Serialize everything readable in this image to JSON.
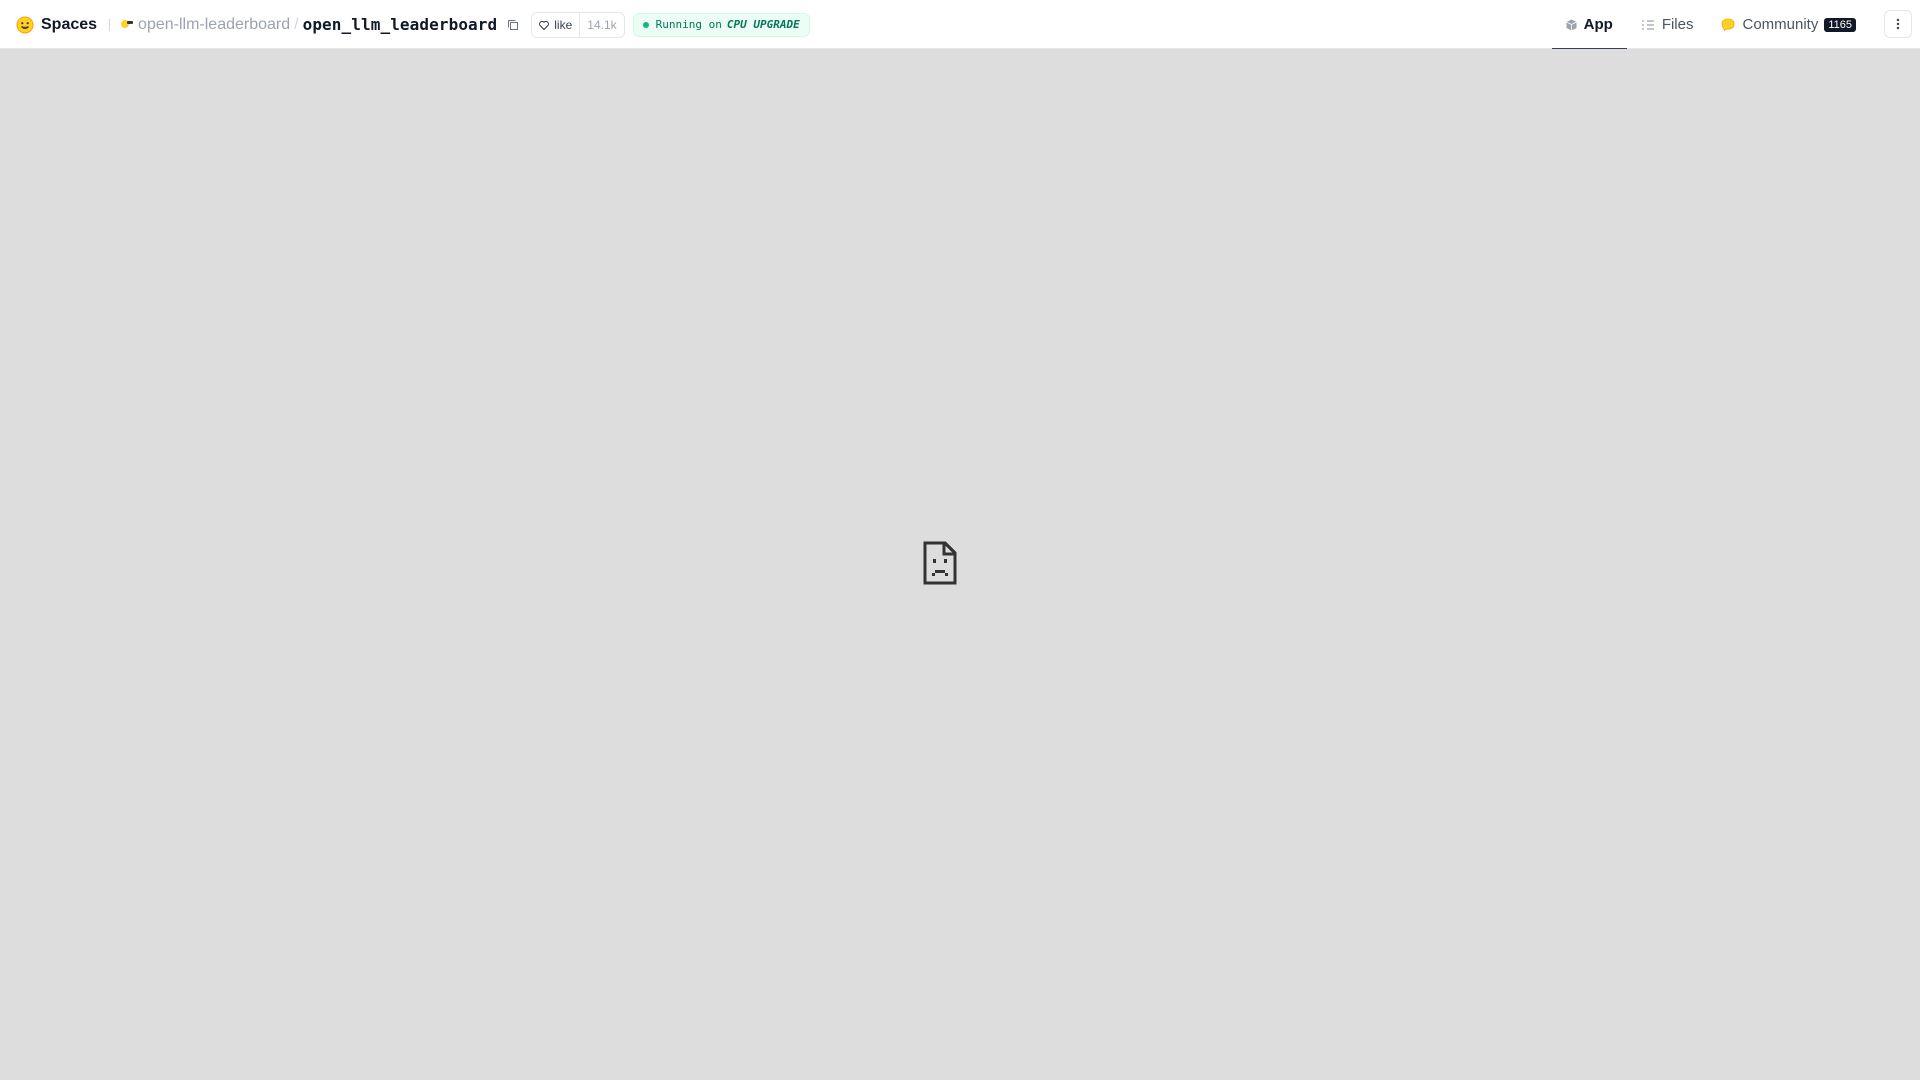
{
  "header": {
    "brand_label": "Spaces",
    "brand_icon": "huggingface-logo-icon",
    "owner": "open-llm-leaderboard",
    "separator": "/",
    "repo": "open_llm_leaderboard",
    "like_label": "like",
    "like_count": "14.1k",
    "status": {
      "text": "Running on",
      "hardware": "CPU UPGRADE",
      "color": "#10b981"
    }
  },
  "tabs": [
    {
      "label": "App",
      "icon": "cube-icon",
      "active": true
    },
    {
      "label": "Files",
      "icon": "files-icon",
      "active": false
    },
    {
      "label": "Community",
      "icon": "community-icon",
      "active": false,
      "count": "1165"
    }
  ],
  "content": {
    "state_icon": "sad-file-icon",
    "background": "#dddddd"
  }
}
